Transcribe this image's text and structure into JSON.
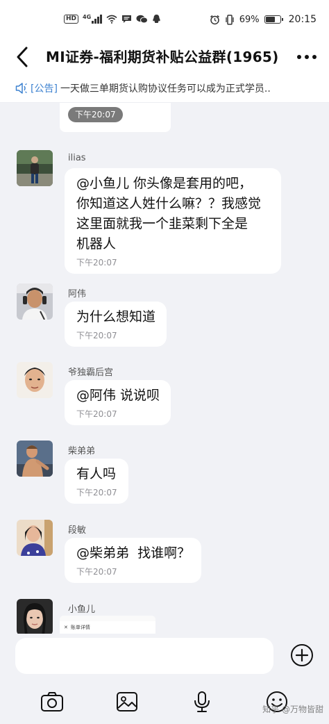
{
  "status_bar": {
    "hd_badge": "HD",
    "network": "4G",
    "battery_percent": "69%",
    "battery_level": 0.69,
    "time": "20:15"
  },
  "header": {
    "title": "MI证券-福利期货补贴公益群(1965)"
  },
  "notice": {
    "tag": "[公告]",
    "text": "一天做三单期货认购协议任务可以成为正式学员.."
  },
  "previous_message": {
    "time": "下午20:07"
  },
  "messages": [
    {
      "sender": "ilias",
      "text": "@小鱼儿 你头像是套用的吧，\n你知道这人姓什么嘛？？我感觉\n这里面就我一个韭菜剩下全是\n机器人",
      "time": "下午20:07"
    },
    {
      "sender": "阿伟",
      "text": "为什么想知道",
      "time": "下午20:07"
    },
    {
      "sender": "爷独霸后宫",
      "text": "@阿伟 说说呗",
      "time": "下午20:07"
    },
    {
      "sender": "柴弟弟",
      "text": "有人吗",
      "time": "下午20:07"
    },
    {
      "sender": "段敏",
      "text": "@柴弟弟  找谁啊？",
      "time": "下午20:07"
    },
    {
      "sender": "小鱼儿",
      "screenshot_label": "账单详情"
    }
  ],
  "watermark": "知乎 @万物皆甜",
  "colors": {
    "accent": "#3d82d0",
    "background": "#f1f2f6",
    "bubble": "#ffffff"
  }
}
